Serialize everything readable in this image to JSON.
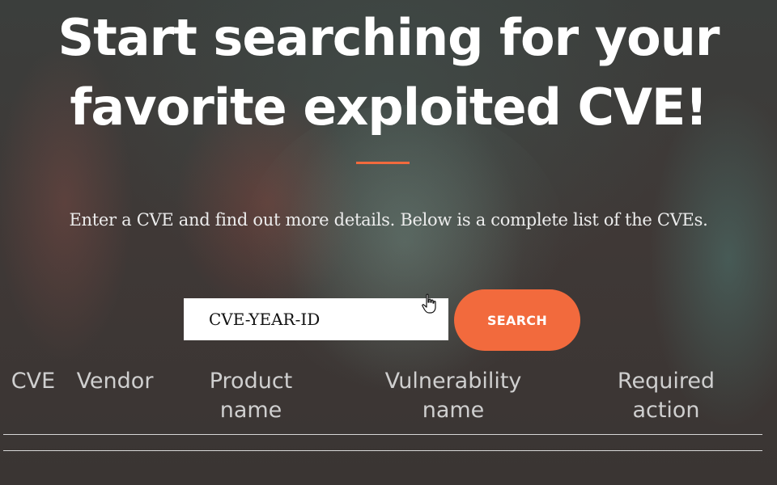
{
  "hero": {
    "title": "Start searching for your favorite exploited CVE!",
    "subtitle": "Enter a CVE and find out more details. Below is a complete list of the CVEs."
  },
  "search": {
    "placeholder": "CVE-YEAR-ID",
    "button_label": "SEARCH"
  },
  "table": {
    "columns": [
      "CVE",
      "Vendor",
      "Product name",
      "Vulnerability name",
      "Required action"
    ]
  },
  "colors": {
    "accent": "#f26a3d",
    "text": "#ffffff",
    "header_text": "#cfcfcf"
  },
  "icons": {
    "cursor": "hand-pointer-icon"
  }
}
